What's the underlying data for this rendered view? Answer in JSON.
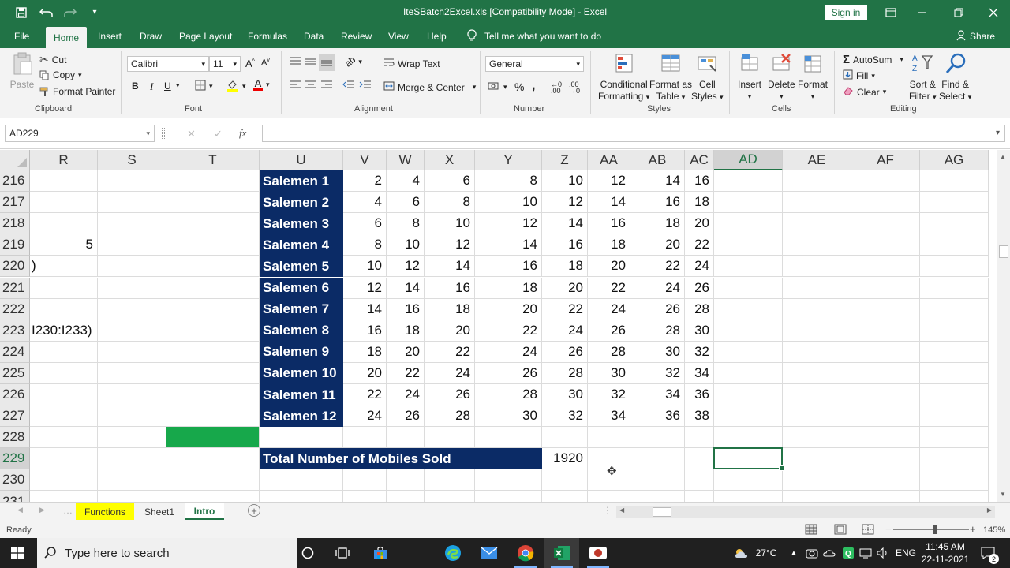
{
  "titlebar": {
    "document_title": "IteSBatch2Excel.xls  [Compatibility Mode]  -  Excel",
    "sign_in": "Sign in",
    "icons": [
      "save-icon",
      "undo-icon",
      "redo-icon",
      "customize-icon",
      "ribbon-display-icon",
      "minimize-icon",
      "maximize-icon",
      "close-icon"
    ]
  },
  "menu": {
    "tabs": [
      "File",
      "Home",
      "Insert",
      "Draw",
      "Page Layout",
      "Formulas",
      "Data",
      "Review",
      "View",
      "Help"
    ],
    "active_tab": "Home",
    "tell_me": "Tell me what you want to do",
    "share": "Share"
  },
  "ribbon": {
    "clipboard": {
      "label": "Clipboard",
      "paste": "Paste",
      "cut": "Cut",
      "copy": "Copy",
      "format_painter": "Format Painter"
    },
    "font": {
      "label": "Font",
      "name": "Calibri",
      "size": "11",
      "bold": "B",
      "italic": "I",
      "underline": "U"
    },
    "alignment": {
      "label": "Alignment",
      "wrap_text": "Wrap Text",
      "merge_center": "Merge & Center"
    },
    "number": {
      "label": "Number",
      "format": "General",
      "percent": "%",
      "comma": ","
    },
    "styles": {
      "label": "Styles",
      "conditional_1": "Conditional",
      "conditional_2": "Formatting",
      "format_table_1": "Format as",
      "format_table_2": "Table",
      "cell_styles_1": "Cell",
      "cell_styles_2": "Styles"
    },
    "cells": {
      "label": "Cells",
      "insert": "Insert",
      "delete": "Delete",
      "format": "Format"
    },
    "editing": {
      "label": "Editing",
      "autosum": "AutoSum",
      "fill": "Fill",
      "clear": "Clear",
      "sort_1": "Sort &",
      "sort_2": "Filter",
      "find_1": "Find &",
      "find_2": "Select"
    }
  },
  "formula_bar": {
    "name_box": "AD229",
    "fx": "fx",
    "cancel": "✕",
    "enter": "✓",
    "value": ""
  },
  "grid": {
    "columns": [
      "R",
      "S",
      "T",
      "U",
      "V",
      "W",
      "X",
      "Y",
      "Z",
      "AA",
      "AB",
      "AC",
      "AD",
      "AE",
      "AF",
      "AG"
    ],
    "selected_column": "AD",
    "rows": [
      "216",
      "217",
      "218",
      "219",
      "220",
      "221",
      "222",
      "223",
      "224",
      "225",
      "226",
      "227",
      "228",
      "229",
      "230",
      "231"
    ],
    "selected_row": "229",
    "r_column": {
      "219": "5",
      "220": ")",
      "223": "I230:I233)"
    },
    "salesmen": [
      {
        "name": "Salemen 1",
        "values": [
          2,
          4,
          6,
          8,
          10,
          12,
          14,
          16
        ]
      },
      {
        "name": "Salemen 2",
        "values": [
          4,
          6,
          8,
          10,
          12,
          14,
          16,
          18
        ]
      },
      {
        "name": "Salemen 3",
        "values": [
          6,
          8,
          10,
          12,
          14,
          16,
          18,
          20
        ]
      },
      {
        "name": "Salemen 4",
        "values": [
          8,
          10,
          12,
          14,
          16,
          18,
          20,
          22
        ]
      },
      {
        "name": "Salemen 5",
        "values": [
          10,
          12,
          14,
          16,
          18,
          20,
          22,
          24
        ]
      },
      {
        "name": "Salemen 6",
        "values": [
          12,
          14,
          16,
          18,
          20,
          22,
          24,
          26
        ]
      },
      {
        "name": "Salemen 7",
        "values": [
          14,
          16,
          18,
          20,
          22,
          24,
          26,
          28
        ]
      },
      {
        "name": "Salemen 8",
        "values": [
          16,
          18,
          20,
          22,
          24,
          26,
          28,
          30
        ]
      },
      {
        "name": "Salemen 9",
        "values": [
          18,
          20,
          22,
          24,
          26,
          28,
          30,
          32
        ]
      },
      {
        "name": "Salemen 10",
        "values": [
          20,
          22,
          24,
          26,
          28,
          30,
          32,
          34
        ]
      },
      {
        "name": "Salemen 11",
        "values": [
          22,
          24,
          26,
          28,
          30,
          32,
          34,
          36
        ]
      },
      {
        "name": "Salemen 12",
        "values": [
          24,
          26,
          28,
          30,
          32,
          34,
          36,
          38
        ]
      }
    ],
    "total_label": "Total Number of Mobiles Sold",
    "total_value": "1920",
    "label_bg": "#0b2b66",
    "highlight_green": "#17a84b"
  },
  "sheets": {
    "tabs": [
      {
        "name": "Functions",
        "style": "yellow"
      },
      {
        "name": "Sheet1",
        "style": "normal"
      },
      {
        "name": "Intro",
        "style": "active"
      }
    ]
  },
  "status": {
    "ready": "Ready",
    "zoom": "145%"
  },
  "taskbar": {
    "search_placeholder": "Type here to search",
    "weather": "27°C",
    "language": "ENG",
    "time": "11:45 AM",
    "date": "22-11-2021",
    "notification_count": "2"
  },
  "colors": {
    "excel_green": "#217346",
    "ribbon_bg": "#f3f3f3",
    "taskbar_bg": "#202020"
  }
}
